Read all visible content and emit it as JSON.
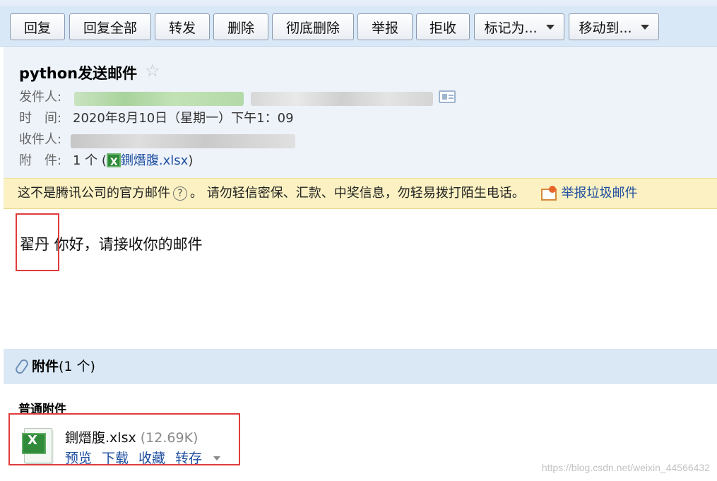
{
  "toolbar": {
    "buttons": [
      "回复",
      "回复全部",
      "转发",
      "删除",
      "彻底删除",
      "举报",
      "拒收"
    ],
    "dropdowns": [
      "标记为...",
      "移动到..."
    ]
  },
  "mail": {
    "subject": "python发送邮件",
    "from_label": "发件人:",
    "time_label": "时　间:",
    "time_value": "2020年8月10日（星期一）下午1：09",
    "to_label": "收件人:",
    "attach_label": "附　件:",
    "attach_count": "1 个 (",
    "attach_name": "鍘熸腹.xlsx",
    "attach_close": ")"
  },
  "warning": {
    "text1": "这不是腾讯公司的官方邮件",
    "text2": "。  请勿轻信密保、汇款、中奖信息，勿轻易拨打陌生电话。",
    "report_link": "举报垃圾邮件"
  },
  "body": {
    "name": "翟丹",
    "text": " 你好，请接收你的邮件"
  },
  "attachments": {
    "title": "附件",
    "count": "(1 个)",
    "section": "普通附件",
    "file_name": "鍘熸腹.xlsx",
    "file_size": "(12.69K)",
    "actions": [
      "预览",
      "下载",
      "收藏",
      "转存"
    ]
  },
  "watermark": "https://blog.csdn.net/weixin_44566432",
  "colors": {
    "accent_link": "#1e4fa0",
    "highlight_box": "#e03c3c",
    "warning_bg": "#fbf1c2",
    "header_bg": "#eef3fa"
  }
}
